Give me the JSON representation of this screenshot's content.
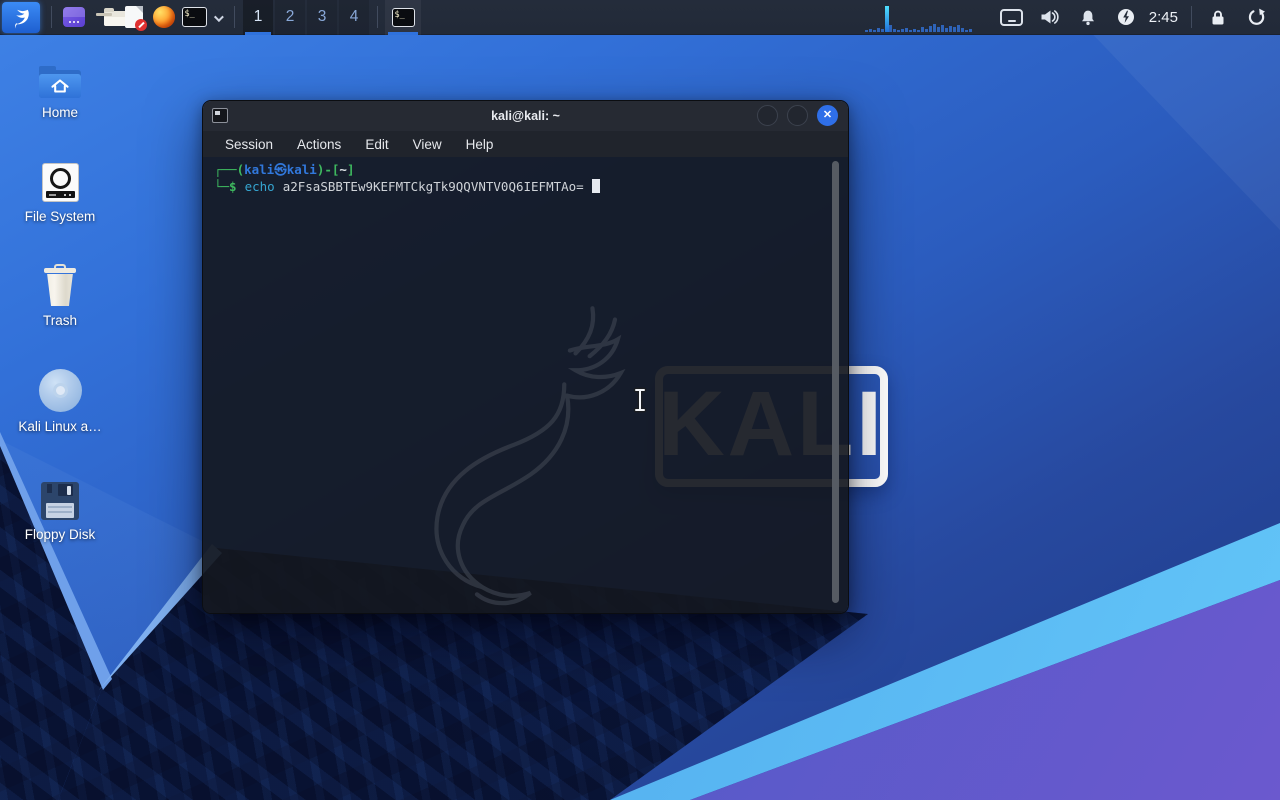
{
  "panel": {
    "menu_button": {
      "icon": "kali-dragon-icon"
    },
    "launchers": [
      {
        "label": "Window Apps",
        "icon": "window-app-icon"
      },
      {
        "label": "File Manager",
        "icon": "folder-icon"
      },
      {
        "label": "Text Editor",
        "icon": "document-edit-icon"
      },
      {
        "label": "Firefox",
        "icon": "firefox-icon"
      },
      {
        "label": "Terminal",
        "icon": "terminal-icon",
        "glyph": "$_"
      }
    ],
    "workspaces": [
      {
        "label": "1",
        "active": true
      },
      {
        "label": "2",
        "active": false
      },
      {
        "label": "3",
        "active": false
      },
      {
        "label": "4",
        "active": false
      }
    ],
    "taskbar": [
      {
        "title": "Terminal",
        "icon": "terminal-icon",
        "glyph": "$_",
        "active": true
      }
    ],
    "tray": {
      "cpu_graph_icon": "cpu-history-graph",
      "screen_icon": "screen-icon",
      "volume_icon": "volume-icon",
      "notifications_icon": "bell-icon",
      "power_icon": "power-manager-icon",
      "clock": "2:45",
      "lock_icon": "lock-icon",
      "logout_icon": "logout-icon"
    }
  },
  "desktop": {
    "icons": [
      {
        "label": "Home",
        "icon": "home-folder-icon"
      },
      {
        "label": "File System",
        "icon": "drive-icon"
      },
      {
        "label": "Trash",
        "icon": "trash-icon"
      },
      {
        "label": "Kali Linux a…",
        "icon": "disc-icon"
      },
      {
        "label": "Floppy Disk",
        "icon": "floppy-icon"
      }
    ],
    "wallpaper_text": "KALI"
  },
  "terminal": {
    "title": "kali@kali: ~",
    "menu": [
      "Session",
      "Actions",
      "Edit",
      "View",
      "Help"
    ],
    "window_buttons": {
      "close_glyph": "✕"
    },
    "prompt": {
      "line1_open": "┌──(",
      "line1_user": "kali㉿kali",
      "line1_mid": ")-[",
      "line1_path": "~",
      "line1_close": "]",
      "line2_frame": "└─$",
      "line2_command": "echo",
      "line2_argument": "a2FsaSBBTEw9KEFMTCkgTk9QQVNTV0Q6IEFMTAo="
    },
    "watermark_icon": "kali-dragon-watermark"
  },
  "cursor": {
    "icon": "ibeam-cursor"
  },
  "colors": {
    "accent_blue": "#367bf0",
    "panel_bg": "#222a38",
    "terminal_bg": "#171a21",
    "prompt_green": "#3eb85f",
    "prompt_blue": "#3178dc",
    "command_cyan": "#35a5d0",
    "close_button_blue": "#2f6fe8",
    "wallpaper_dark_navy": "#0c1c48",
    "wallpaper_stripe_cyan": "#55b1f0",
    "wallpaper_purple": "#6b59ce"
  }
}
